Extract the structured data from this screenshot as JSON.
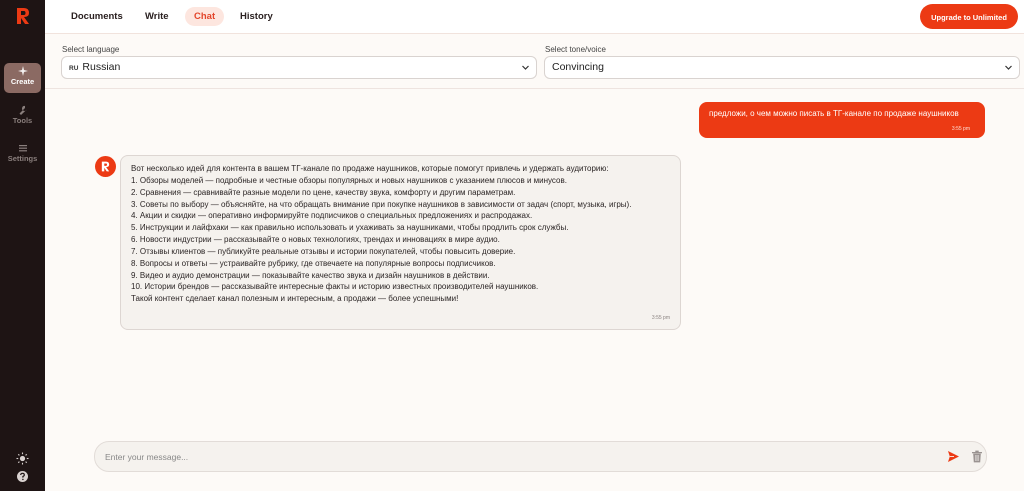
{
  "app": {
    "logo_letter": "R",
    "accent": "#ec3a14"
  },
  "sidebar": {
    "items": [
      {
        "label": "Create",
        "icon": "sparkle-icon",
        "active": true
      },
      {
        "label": "Tools",
        "icon": "wrench-icon",
        "active": false
      },
      {
        "label": "Settings",
        "icon": "menu-lines-icon",
        "active": false
      }
    ],
    "bottom_icons": [
      "sun-icon",
      "help-icon"
    ]
  },
  "topnav": {
    "tabs": [
      {
        "label": "Documents"
      },
      {
        "label": "Write"
      },
      {
        "label": "Chat",
        "active": true
      },
      {
        "label": "History"
      }
    ],
    "upgrade_label": "Upgrade to Unlimited"
  },
  "controls": {
    "language": {
      "label": "Select language",
      "flag": "RU",
      "value": "Russian"
    },
    "tone": {
      "label": "Select tone/voice",
      "value": "Convincing"
    }
  },
  "chat": {
    "user_message": {
      "text": "предложи, о чем можно писать в ТГ-канале по продаже наушников",
      "time": "3:55 pm"
    },
    "bot_message": {
      "lines": [
        "Вот несколько идей для контента в вашем ТГ-канале по продаже наушников, которые помогут привлечь и удержать аудиторию:",
        "1. Обзоры моделей — подробные и честные обзоры популярных и новых наушников с указанием плюсов и минусов.",
        "2. Сравнения — сравнивайте разные модели по цене, качеству звука, комфорту и другим параметрам.",
        "3. Советы по выбору — объясняйте, на что обращать внимание при покупке наушников в зависимости от задач (спорт, музыка, игры).",
        "4. Акции и скидки — оперативно информируйте подписчиков о специальных предложениях и распродажах.",
        "5. Инструкции и лайфхаки — как правильно использовать и ухаживать за наушниками, чтобы продлить срок службы.",
        "6. Новости индустрии — рассказывайте о новых технологиях, трендах и инновациях в мире аудио.",
        "7. Отзывы клиентов — публикуйте реальные отзывы и истории покупателей, чтобы повысить доверие.",
        "8. Вопросы и ответы — устраивайте рубрику, где отвечаете на популярные вопросы подписчиков.",
        "9. Видео и аудио демонстрации — показывайте качество звука и дизайн наушников в действии.",
        "10. Истории брендов — рассказывайте интересные факты и историю известных производителей наушников.",
        "Такой контент сделает канал полезным и интересным, а продажи — более успешными!"
      ],
      "time": "3:55 pm"
    }
  },
  "composer": {
    "placeholder": "Enter your message..."
  }
}
